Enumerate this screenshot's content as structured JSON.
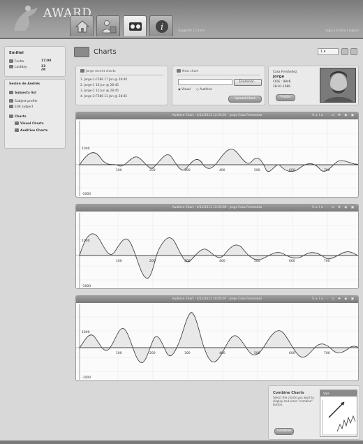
{
  "app": {
    "logo_text": "AWARD"
  },
  "header": {
    "links": "Supports | Charts",
    "user_links": "login | Emilio | logout",
    "tabs": [
      {
        "name": "home",
        "icon": "house-icon"
      },
      {
        "name": "users",
        "icon": "people-icon"
      },
      {
        "name": "charts",
        "icon": "film-icon"
      },
      {
        "name": "info",
        "icon": "info-icon"
      }
    ]
  },
  "user_box": {
    "name": "Emiliel",
    "row1_label": "Fecha",
    "row1_value": "17:00",
    "row2_label": "Lastday",
    "row2_value": "33 /M"
  },
  "nav": {
    "section1": "Sesión de Andrés",
    "item_subjects": "Subjects list",
    "item_profile": "Subject profile",
    "item_edit": "Edit subject",
    "section_charts": "Charts",
    "item_visual": "Visual Charts",
    "item_auditive": "Auditive Charts"
  },
  "page": {
    "title": "Charts",
    "select_value": "1"
  },
  "jorge_box": {
    "title": "Jorge recent charts",
    "items": [
      "1. Jorge-1-F586 17 Jan @ 28:40",
      "2. Jorge-1 16 Jun @ 28:45",
      "3. Jorge-1 12 Jun @ 28:45",
      "4. Jorge-2-F586 11 Jan @ 28:45"
    ]
  },
  "new_box": {
    "title": "New chart",
    "examine_label": "Examinar...",
    "radio_visual": "Visual",
    "radio_auditive": "Auditive",
    "upload_label": "Upload Chart"
  },
  "profile_box": {
    "line1": "Casa Fernández,",
    "name": "Jorge",
    "line3": "CIDE : 9846",
    "line4": "28-01-1986",
    "button": "Profile"
  },
  "charts": [
    {
      "title": "Auditive Chart - 4/12/2011 12:35:02 - Jorge Casa Fernandez",
      "tools": "Sala · ⊙ ✚ ◉ ▣"
    },
    {
      "title": "Auditive Chart - 4/12/2011 12:35:09 - Jorge Casa Fernandez",
      "tools": "Sala · ⊙ ✚ ◉ ▣"
    },
    {
      "title": "Auditive Chart - 4/12/2011 16:05:07 - Jorge Casa Fernandez",
      "tools": "Sala · ⊙ ✚ ◉ ▣"
    }
  ],
  "chart_axis": {
    "y_top": "1000",
    "y_bottom": "-1000",
    "x_ticks": [
      "100",
      "200",
      "300",
      "400",
      "500",
      "600",
      "700"
    ]
  },
  "combine": {
    "title": "Combine Charts",
    "desc": "Select the charts you want to display and press \"combine\" button.",
    "button": "Combine",
    "thumb_label": "Sala"
  }
}
